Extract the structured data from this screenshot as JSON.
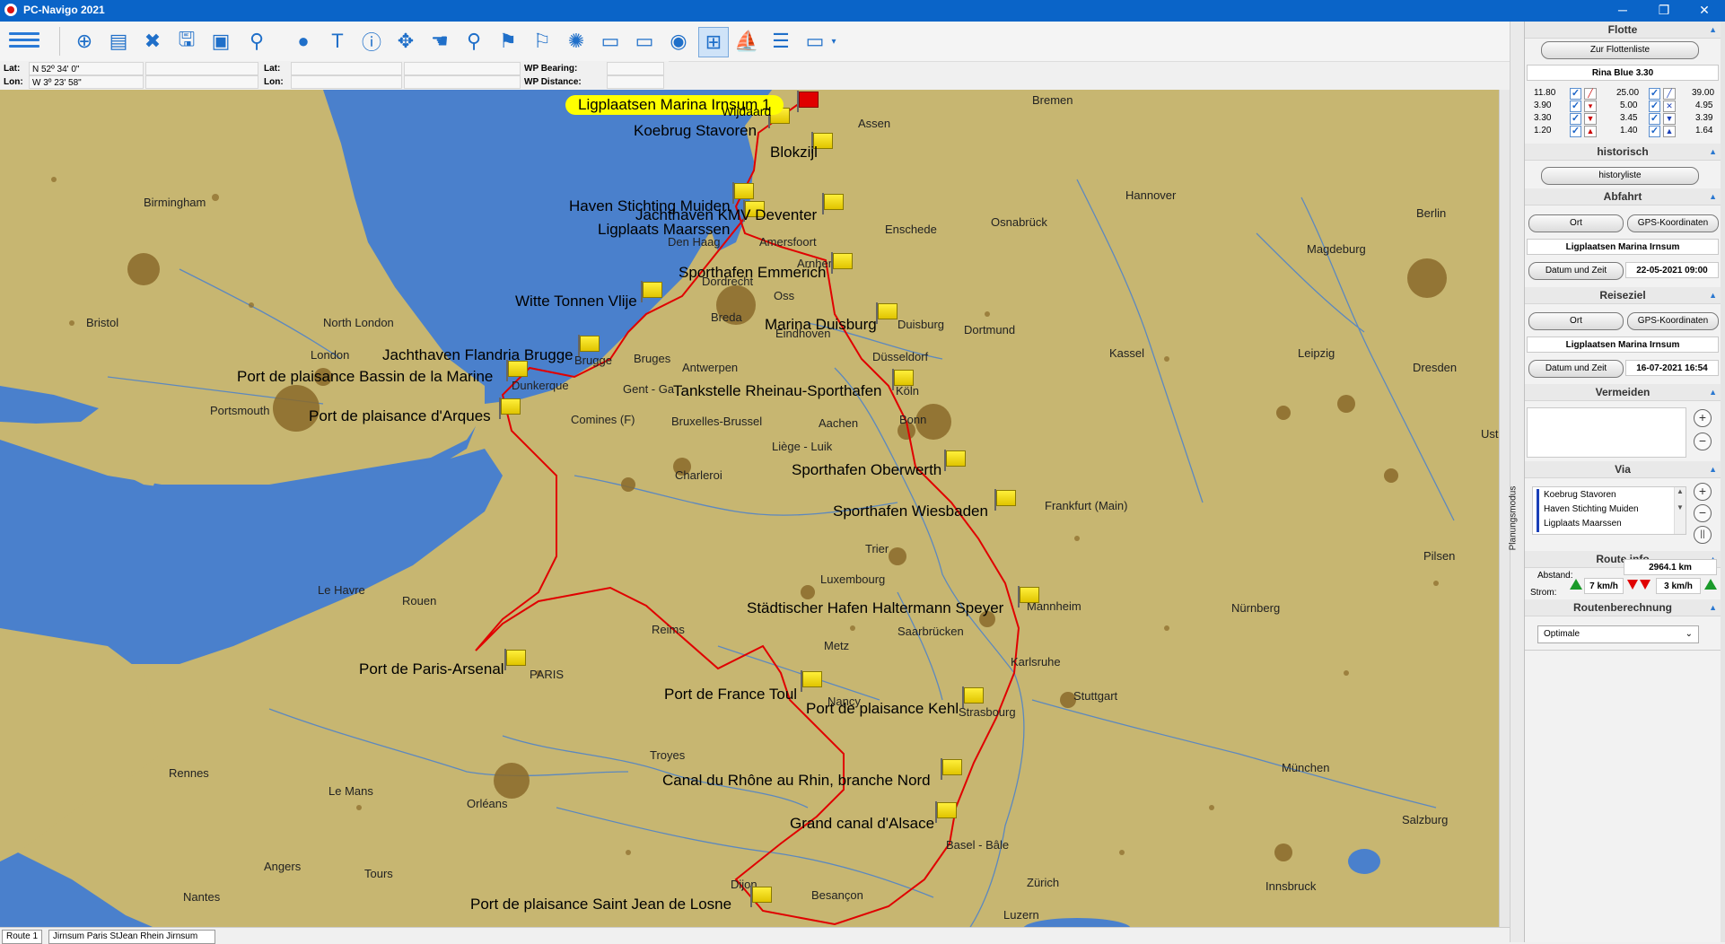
{
  "window": {
    "title": "PC-Navigo 2021",
    "controls": {
      "minimize": "─",
      "restore": "❐",
      "close": "✕"
    }
  },
  "toolbar": {
    "icons": [
      "add-waypoint-icon",
      "layers-icon",
      "delete-route-icon",
      "save-icon",
      "image-icon",
      "search-icon",
      "globe-icon",
      "text-icon",
      "info-icon",
      "move-icon",
      "hand-icon",
      "pin-icon",
      "flag-icon",
      "pin-info-icon",
      "sun-icon",
      "monitor-icon",
      "monitor-off-icon",
      "compass-icon",
      "route-grid-icon",
      "boat-icon",
      "list-icon",
      "display-icon"
    ]
  },
  "coords": {
    "lat_label": "Lat:",
    "lat_value": "N 52º 34' 0\"",
    "lon_label": "Lon:",
    "lon_value": "W 3º 23' 58\"",
    "lat2_label": "Lat:",
    "lon2_label": "Lon:",
    "wp_bearing_label": "WP Bearing:",
    "wp_distance_label": "WP Distance:"
  },
  "map": {
    "cities": [
      {
        "name": "Birmingham"
      },
      {
        "name": "Bristol"
      },
      {
        "name": "North London"
      },
      {
        "name": "London"
      },
      {
        "name": "Portsmouth"
      },
      {
        "name": "Den Haag"
      },
      {
        "name": "Dordrecht"
      },
      {
        "name": "Amersfoort"
      },
      {
        "name": "Arnhem"
      },
      {
        "name": "Oss"
      },
      {
        "name": "Breda"
      },
      {
        "name": "Eindhoven"
      },
      {
        "name": "Antwerpen"
      },
      {
        "name": "Bruges"
      },
      {
        "name": "Brugge"
      },
      {
        "name": "Gent - Ga"
      },
      {
        "name": "Dunkerque"
      },
      {
        "name": "Comines (F)"
      },
      {
        "name": "Bruxelles-Brussel"
      },
      {
        "name": "Aachen"
      },
      {
        "name": "Liège - Luik"
      },
      {
        "name": "Charleroi"
      },
      {
        "name": "Assen"
      },
      {
        "name": "Bremen"
      },
      {
        "name": "Hannover"
      },
      {
        "name": "Osnabrück"
      },
      {
        "name": "Enschede"
      },
      {
        "name": "Duisburg"
      },
      {
        "name": "Dortmund"
      },
      {
        "name": "Düsseldorf"
      },
      {
        "name": "Köln"
      },
      {
        "name": "Bonn"
      },
      {
        "name": "Kassel"
      },
      {
        "name": "Leipzig"
      },
      {
        "name": "Magdeburg"
      },
      {
        "name": "Berlin"
      },
      {
        "name": "Dresden"
      },
      {
        "name": "Frankfurt (Main)"
      },
      {
        "name": "Trier"
      },
      {
        "name": "Luxembourg"
      },
      {
        "name": "Mannheim"
      },
      {
        "name": "Saarbrücken"
      },
      {
        "name": "Metz"
      },
      {
        "name": "Nancy"
      },
      {
        "name": "Karlsruhe"
      },
      {
        "name": "Strasbourg"
      },
      {
        "name": "Stuttgart"
      },
      {
        "name": "Nürnberg"
      },
      {
        "name": "Pilsen"
      },
      {
        "name": "München"
      },
      {
        "name": "Salzburg"
      },
      {
        "name": "Innsbruck"
      },
      {
        "name": "Zürich"
      },
      {
        "name": "Luzern"
      },
      {
        "name": "Basel - Bâle"
      },
      {
        "name": "Besançon"
      },
      {
        "name": "Dijon"
      },
      {
        "name": "Troyes"
      },
      {
        "name": "Reims"
      },
      {
        "name": "PARIS"
      },
      {
        "name": "Rouen"
      },
      {
        "name": "Le Havre"
      },
      {
        "name": "Rennes"
      },
      {
        "name": "Le Mans"
      },
      {
        "name": "Orléans"
      },
      {
        "name": "Angers"
      },
      {
        "name": "Tours"
      },
      {
        "name": "Nantes"
      },
      {
        "name": "Ust"
      }
    ],
    "waypoints": [
      {
        "name": "Ligplaatsen Marina Irnsum 1",
        "start": true
      },
      {
        "name": "Koebrug Stavoren"
      },
      {
        "name": "Blokzijl"
      },
      {
        "name": "Haven Stichting Muiden"
      },
      {
        "name": "Jachthaven KMV Deventer"
      },
      {
        "name": "Ligplaats Maarssen"
      },
      {
        "name": "Sporthafen Emmerich"
      },
      {
        "name": "Witte Tonnen Vlije"
      },
      {
        "name": "Marina Duisburg"
      },
      {
        "name": "Jachthaven Flandria Brugge"
      },
      {
        "name": "Port de plaisance Bassin de la Marine"
      },
      {
        "name": "Tankstelle Rheinau-Sporthafen"
      },
      {
        "name": "Port de plaisance d'Arques"
      },
      {
        "name": "Sporthafen Oberwerth"
      },
      {
        "name": "Sporthafen Wiesbaden"
      },
      {
        "name": "Städtischer Hafen Haltermann Speyer"
      },
      {
        "name": "Port de Paris-Arsenal"
      },
      {
        "name": "Port de France Toul"
      },
      {
        "name": "Port de plaisance Kehl"
      },
      {
        "name": "Canal du Rhône au Rhin, branche Nord"
      },
      {
        "name": "Grand canal d'Alsace"
      },
      {
        "name": "Port de plaisance Saint Jean de Losne"
      },
      {
        "name": "Wijdaard"
      }
    ]
  },
  "status": {
    "tab1": "Route 1",
    "tab2": "Jirnsum Paris StJean Rhein Jirnsum"
  },
  "panel": {
    "planning_mode": "Planungsmodus",
    "flotte": {
      "header": "Flotte",
      "fleet_list_button": "Zur Flottenliste",
      "boat_name": "Rina Blue 3.30",
      "values_left": [
        "11.80",
        "3.90",
        "3.30",
        "1.20"
      ],
      "values_mid": [
        "25.00",
        "5.00",
        "3.45",
        "1.40"
      ],
      "values_right": [
        "39.00",
        "4.95",
        "3.39",
        "1.64"
      ]
    },
    "historisch": {
      "header": "historisch",
      "button": "historyliste"
    },
    "abfahrt": {
      "header": "Abfahrt",
      "ort_button": "Ort",
      "gps_button": "GPS-Koordinaten",
      "place": "Ligplaatsen Marina Irnsum",
      "date_button": "Datum und Zeit",
      "datetime": "22-05-2021 09:00"
    },
    "reiseziel": {
      "header": "Reiseziel",
      "ort_button": "Ort",
      "gps_button": "GPS-Koordinaten",
      "place": "Ligplaatsen Marina Irnsum",
      "date_button": "Datum und Zeit",
      "datetime": "16-07-2021 16:54"
    },
    "vermeiden": {
      "header": "Vermeiden",
      "add": "+",
      "remove": "−"
    },
    "via": {
      "header": "Via",
      "items": [
        "Koebrug Stavoren",
        "Haven Stichting Muiden",
        "Ligplaats Maarssen"
      ],
      "add": "+",
      "remove": "−",
      "pause": "||"
    },
    "routeinfo": {
      "header": "Route info",
      "distance_label": "Abstand:",
      "distance_value": "2964.1 km",
      "current_label": "Strom:",
      "current_up": "7 km/h",
      "current_down": "3 km/h"
    },
    "routenberechnung": {
      "header": "Routenberechnung",
      "selected": "Optimale"
    }
  },
  "colors": {
    "titlebar": "#0a64c8",
    "land": "#c7b671",
    "water": "#4a80cc",
    "route": "#e00000",
    "flag": "#f2dd10"
  }
}
